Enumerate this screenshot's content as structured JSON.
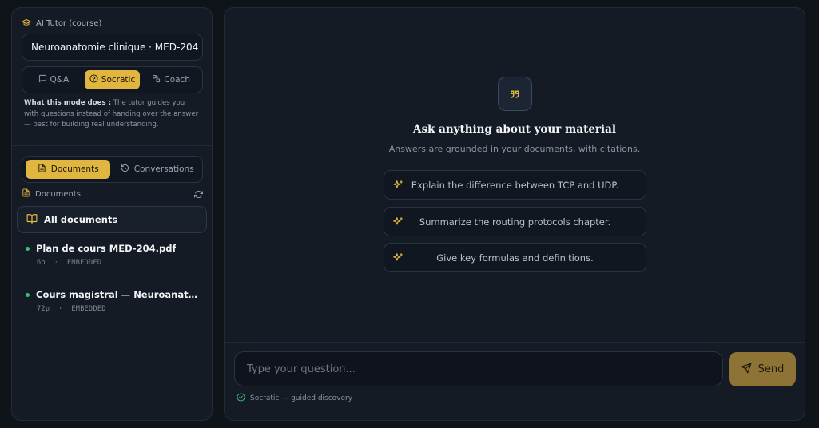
{
  "sidebar": {
    "brand_label": "AI Tutor (course)",
    "course_title": "Neuroanatomie clinique · MED-204",
    "modes": [
      {
        "label": "Q&A",
        "active": false
      },
      {
        "label": "Socratic",
        "active": true
      },
      {
        "label": "Coach",
        "active": false
      }
    ],
    "mode_desc_heading": "What this mode does :",
    "mode_desc_text": " The tutor guides you with questions instead of handing over the answer — best for building real understanding.",
    "tabs": [
      {
        "label": "Documents",
        "active": true
      },
      {
        "label": "Conversations",
        "active": false
      }
    ],
    "documents_heading": "Documents",
    "all_documents_label": "All documents",
    "documents": [
      {
        "name": "Plan de cours MED-204.pdf",
        "pages": "6p",
        "status": "EMBEDDED"
      },
      {
        "name": "Cours magistral — Neuroanatomie",
        "pages": "72p",
        "status": "EMBEDDED"
      }
    ],
    "meta_separator": "·"
  },
  "main": {
    "hero_title": "Ask anything about your material",
    "hero_subtitle": "Answers are grounded in your documents, with citations.",
    "suggestions": [
      "Explain the difference between TCP and UDP.",
      "Summarize the routing protocols chapter.",
      "Give key formulas and definitions."
    ],
    "input_placeholder": "Type your question...",
    "send_label": "Send",
    "mode_status": "Socratic — guided discovery"
  },
  "colors": {
    "accent": "#e0b640",
    "status_dot": "#34c27a",
    "background": "#0f141b",
    "panel": "#151b24"
  },
  "icons": {
    "brand": "graduation-cap-icon",
    "qa": "message-square-icon",
    "socratic": "help-circle-icon",
    "coach": "shapes-icon",
    "documents_tab": "file-text-icon",
    "conversations_tab": "history-icon",
    "refresh": "refresh-icon",
    "all_documents": "book-open-icon",
    "hero": "quote-icon",
    "suggestion": "sparkles-icon",
    "send": "send-icon",
    "mode_status": "check-circle-icon"
  }
}
